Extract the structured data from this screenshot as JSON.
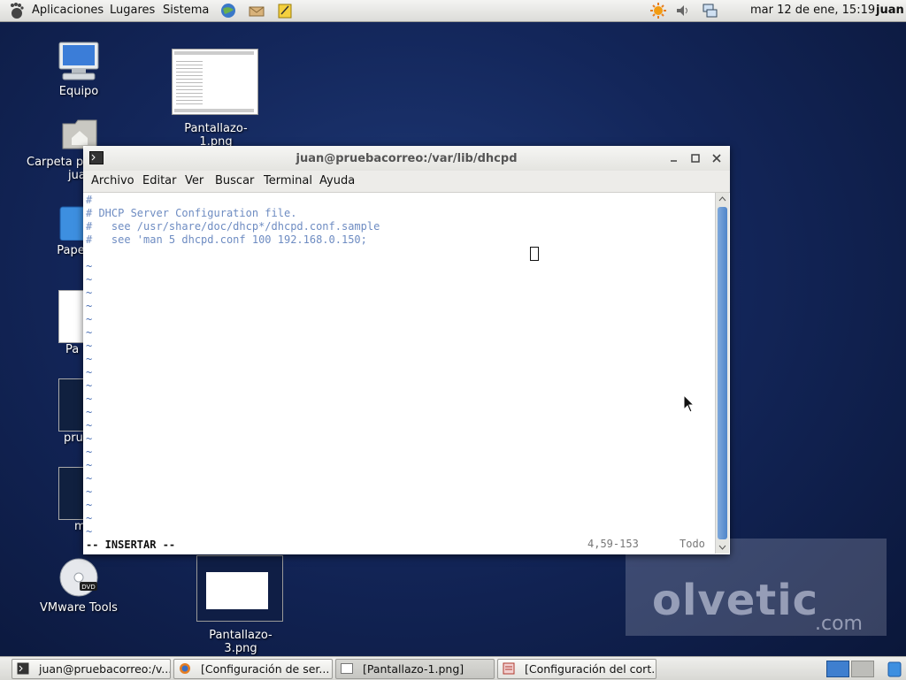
{
  "top_panel": {
    "menus": [
      "Aplicaciones",
      "Lugares",
      "Sistema"
    ],
    "datetime": "mar 12 de ene, 15:19",
    "user": "juan"
  },
  "desktop": {
    "icons": [
      {
        "label": "Equipo"
      },
      {
        "label": "Carpeta pe",
        "label2": "jua"
      },
      {
        "label": "Pape"
      },
      {
        "label": "Pa"
      },
      {
        "label": "pru"
      },
      {
        "label": "m"
      },
      {
        "label": "VMware Tools"
      },
      {
        "label": "Pantallazo-1.png"
      },
      {
        "label": "Pantallazo-3.png"
      }
    ]
  },
  "terminal": {
    "title": "juan@pruebacorreo:/var/lib/dhcpd",
    "menu": [
      "Archivo",
      "Editar",
      "Ver",
      "Buscar",
      "Terminal",
      "Ayuda"
    ],
    "lines": [
      "#",
      "# DHCP Server Configuration file.",
      "#   see /usr/share/doc/dhcp*/dhcpd.conf.sample",
      "#   see 'man 5 dhcpd.conf 100 192.168.0.150;"
    ],
    "tilde": "~",
    "mode": "-- INSERTAR --",
    "position": "4,59-153",
    "scroll": "Todo"
  },
  "taskbar": {
    "tasks": [
      "juan@pruebacorreo:/v...",
      "[Configuración de ser...",
      "[Pantallazo-1.png]",
      "[Configuración del cort..."
    ]
  },
  "watermark": "olvetic",
  "watermark_sub": ".com",
  "colors": {
    "accent": "#4f85c9",
    "desktop": "#13265a"
  }
}
